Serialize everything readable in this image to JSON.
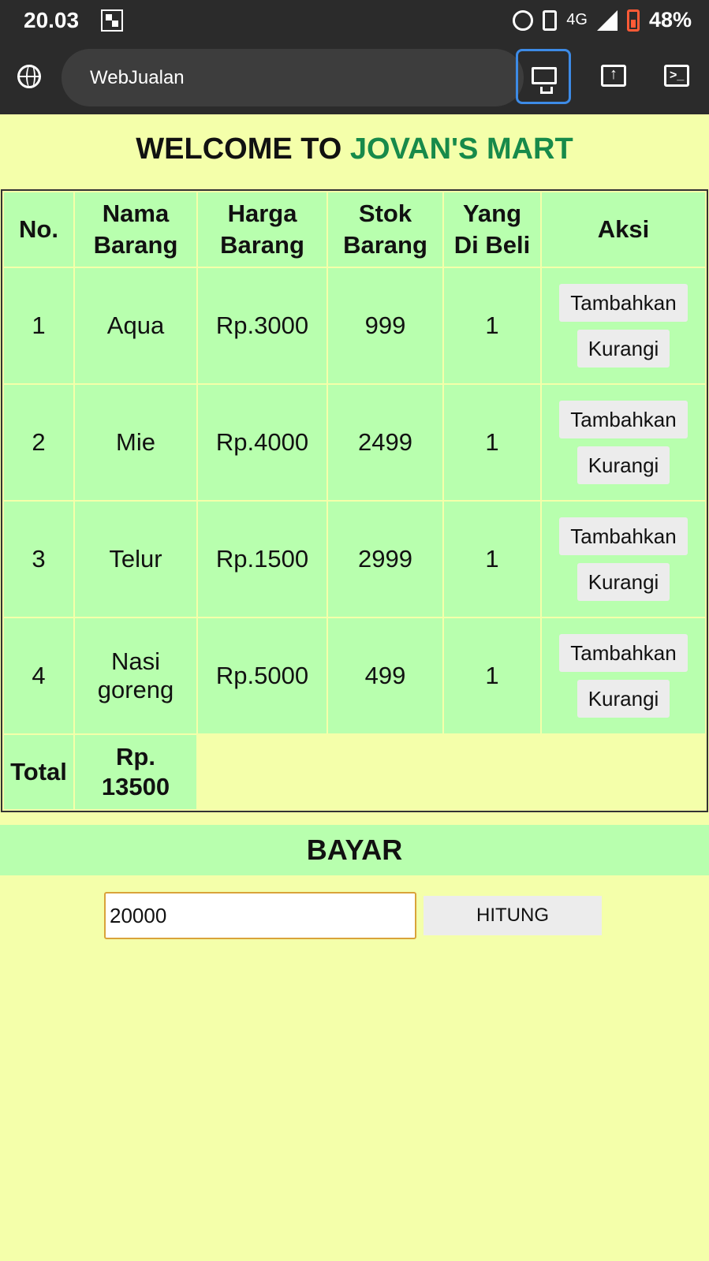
{
  "status_bar": {
    "time": "20.03",
    "network": "4G",
    "battery": "48%"
  },
  "browser": {
    "url_text": "WebJualan",
    "icons": [
      "globe-icon",
      "desktop-icon",
      "share-icon",
      "console-icon"
    ]
  },
  "header": {
    "prefix": "WELCOME TO",
    "brand": "JOVAN'S MART",
    "brand_color": "#178a4a"
  },
  "table": {
    "headers": {
      "no": "No.",
      "nama_1": "Nama",
      "nama_2": "Barang",
      "harga_1": "Harga",
      "harga_2": "Barang",
      "stok_1": "Stok",
      "stok_2": "Barang",
      "beli_1": "Yang",
      "beli_2": "Di Beli",
      "aksi": "Aksi"
    },
    "rows": [
      {
        "no": "1",
        "nama": "Aqua",
        "nama_2": "",
        "harga": "Rp.3000",
        "stok": "999",
        "beli": "1",
        "tambah": "Tambahkan",
        "kurangi": "Kurangi"
      },
      {
        "no": "2",
        "nama": "Mie",
        "nama_2": "",
        "harga": "Rp.4000",
        "stok": "2499",
        "beli": "1",
        "tambah": "Tambahkan",
        "kurangi": "Kurangi"
      },
      {
        "no": "3",
        "nama": "Telur",
        "nama_2": "",
        "harga": "Rp.1500",
        "stok": "2999",
        "beli": "1",
        "tambah": "Tambahkan",
        "kurangi": "Kurangi"
      },
      {
        "no": "4",
        "nama": "Nasi",
        "nama_2": "goreng",
        "harga": "Rp.5000",
        "stok": "499",
        "beli": "1",
        "tambah": "Tambahkan",
        "kurangi": "Kurangi"
      }
    ],
    "total_label": "Total",
    "total_value_1": "Rp.",
    "total_value_2": "13500"
  },
  "payment": {
    "title": "BAYAR",
    "input_value": "20000",
    "button_label": "HITUNG"
  },
  "colors": {
    "page_bg": "#f4ffaa",
    "cell_bg": "#b8ffae",
    "input_border": "#d9a33a"
  }
}
